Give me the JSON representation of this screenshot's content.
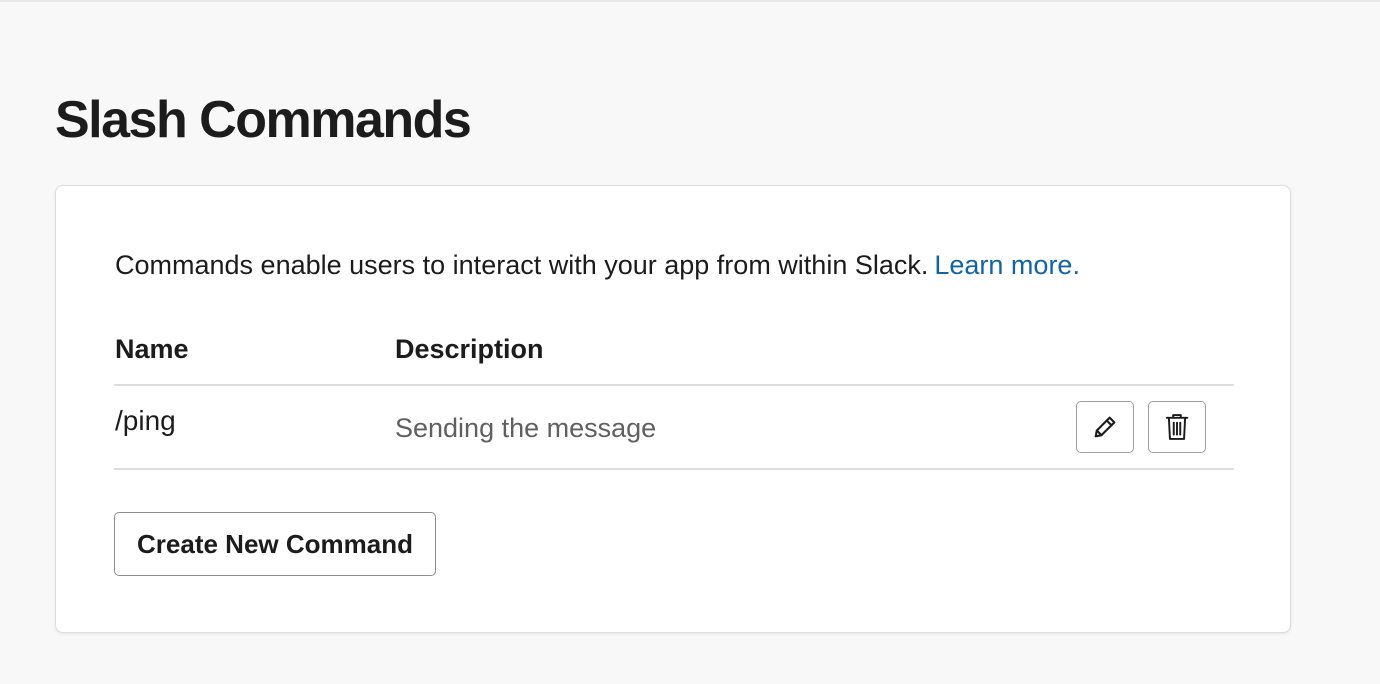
{
  "page": {
    "title": "Slash Commands"
  },
  "card": {
    "intro_text": "Commands enable users to interact with your app from within Slack.",
    "learn_more_label": "Learn more."
  },
  "table": {
    "headers": [
      "Name",
      "Description"
    ],
    "rows": [
      {
        "name": "/ping",
        "description": "Sending the message",
        "actions": [
          "pencil-icon",
          "trash-icon"
        ]
      }
    ]
  },
  "create_button_label": "Create New Command",
  "colors": {
    "background": "#f8f8f8",
    "card": "#ffffff",
    "link": "#1264a3",
    "text": "#1d1c1d",
    "muted_text": "#616061",
    "border": "#dddddd"
  }
}
